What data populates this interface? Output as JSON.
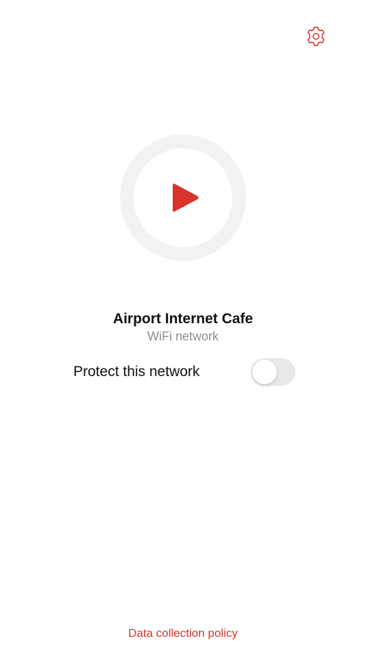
{
  "colors": {
    "accent": "#d9342b",
    "ring": "#f2f2f2",
    "toggle_off": "#e9e9ea",
    "secondary_text": "#8e8e93"
  },
  "header": {
    "settings_icon": "gear-icon"
  },
  "connect": {
    "icon": "play-icon"
  },
  "network": {
    "name": "Airport Internet Cafe",
    "type": "WiFi network"
  },
  "protect": {
    "label": "Protect this network",
    "enabled": false
  },
  "footer": {
    "policy_link": "Data collection policy"
  }
}
